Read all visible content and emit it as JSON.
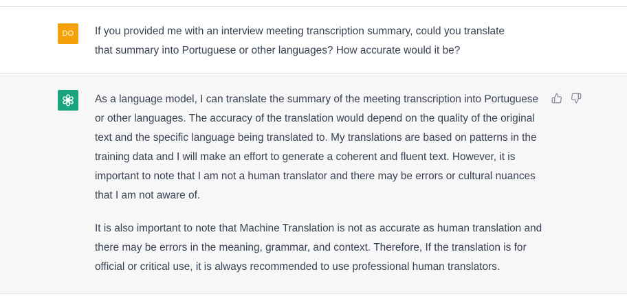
{
  "colors": {
    "user_avatar_bg": "#f5a20a",
    "bot_avatar_bg": "#19a37f",
    "text": "#374151",
    "assistant_bg": "#f7f7f8"
  },
  "user_message": {
    "avatar_initials": "DO",
    "text_line1": "If you provided me with an interview meeting transcription summary, could you translate",
    "text_line2": "that summary into Portuguese or other languages? How accurate would it be?"
  },
  "assistant_message": {
    "avatar_icon": "openai-logo-icon",
    "paragraphs": [
      "As a language model, I can translate the summary of the meeting transcription into Portuguese or other languages. The accuracy of the translation would depend on the quality of the original text and the specific language being translated to. My translations are based on patterns in the training data and I will make an effort to generate a coherent and fluent text. However, it is important to note that I am not a human translator and there may be errors or cultural nuances that I am not aware of.",
      "It is also important to note that Machine Translation is not as accurate as human translation and there may be errors in the meaning, grammar, and context. Therefore, If the translation is for official or critical use, it is always recommended to use professional human translators."
    ],
    "feedback_icons": [
      "thumbs-up-icon",
      "thumbs-down-icon"
    ]
  }
}
